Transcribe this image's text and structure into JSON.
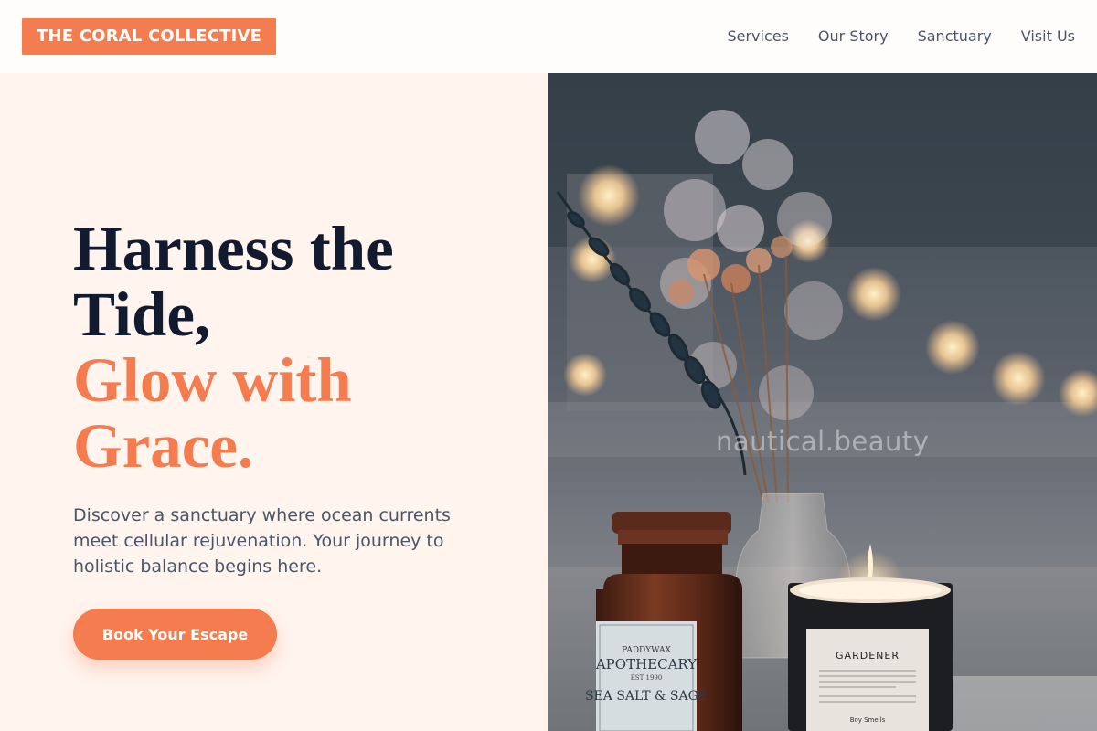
{
  "brand": {
    "name": "THE CORAL COLLECTIVE"
  },
  "nav": {
    "items": [
      "Services",
      "Our Story",
      "Sanctuary",
      "Visit Us"
    ]
  },
  "hero": {
    "headline_line1": "Harness the",
    "headline_line2": "Tide,",
    "headline_accent1": "Glow with",
    "headline_accent2": "Grace.",
    "description": "Discover a sanctuary where ocean currents meet cellular rejuvenation. Your journey to holistic balance begins here.",
    "cta_label": "Book Your Escape",
    "image_watermark": "nautical.beauty",
    "jar_label_brand": "PADDYWAX",
    "jar_label_title": "APOTHECARY",
    "jar_label_year": "EST 1990",
    "jar_label_scent": "SEA SALT & SAGE",
    "candle_label": "GARDENER",
    "candle_sub": "Boy Smells"
  },
  "colors": {
    "accent": "#f57c4f",
    "heading": "#121a2f",
    "body": "#4a5568",
    "background": "#fff4ee"
  }
}
